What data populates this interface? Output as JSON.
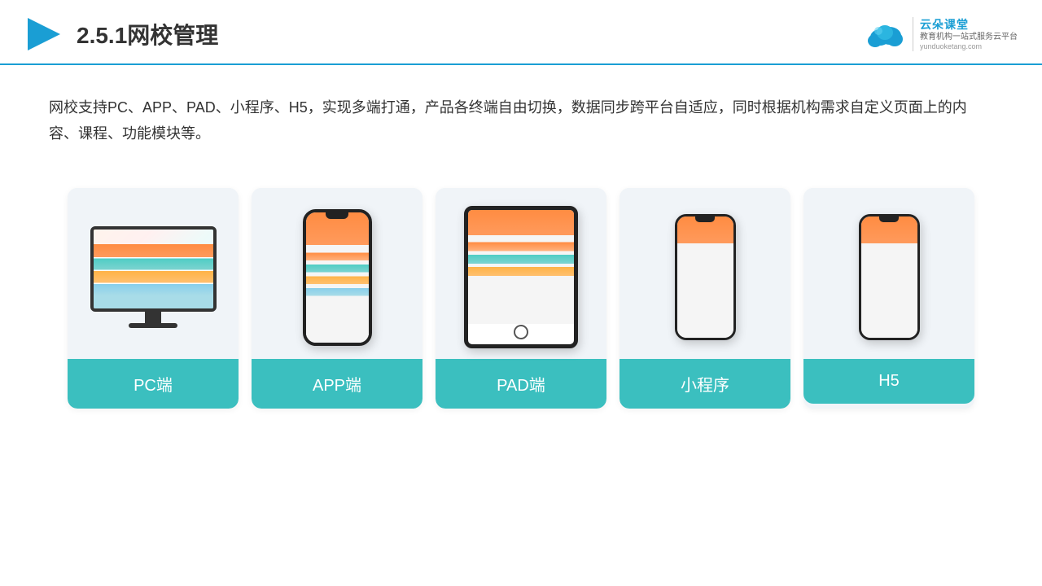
{
  "header": {
    "title": "2.5.1网校管理",
    "logo_main": "云朵课堂",
    "logo_sub": "教育机构一站式服务云平台",
    "logo_url": "yunduoketang.com"
  },
  "description": {
    "text": "网校支持PC、APP、PAD、小程序、H5，实现多端打通，产品各终端自由切换，数据同步跨平台自适应，同时根据机构需求自定义页面上的内容、课程、功能模块等。"
  },
  "cards": [
    {
      "id": "pc",
      "label": "PC端",
      "device": "pc"
    },
    {
      "id": "app",
      "label": "APP端",
      "device": "phone"
    },
    {
      "id": "pad",
      "label": "PAD端",
      "device": "tablet"
    },
    {
      "id": "miniprogram",
      "label": "小程序",
      "device": "phone-mini"
    },
    {
      "id": "h5",
      "label": "H5",
      "device": "phone-mini2"
    }
  ]
}
